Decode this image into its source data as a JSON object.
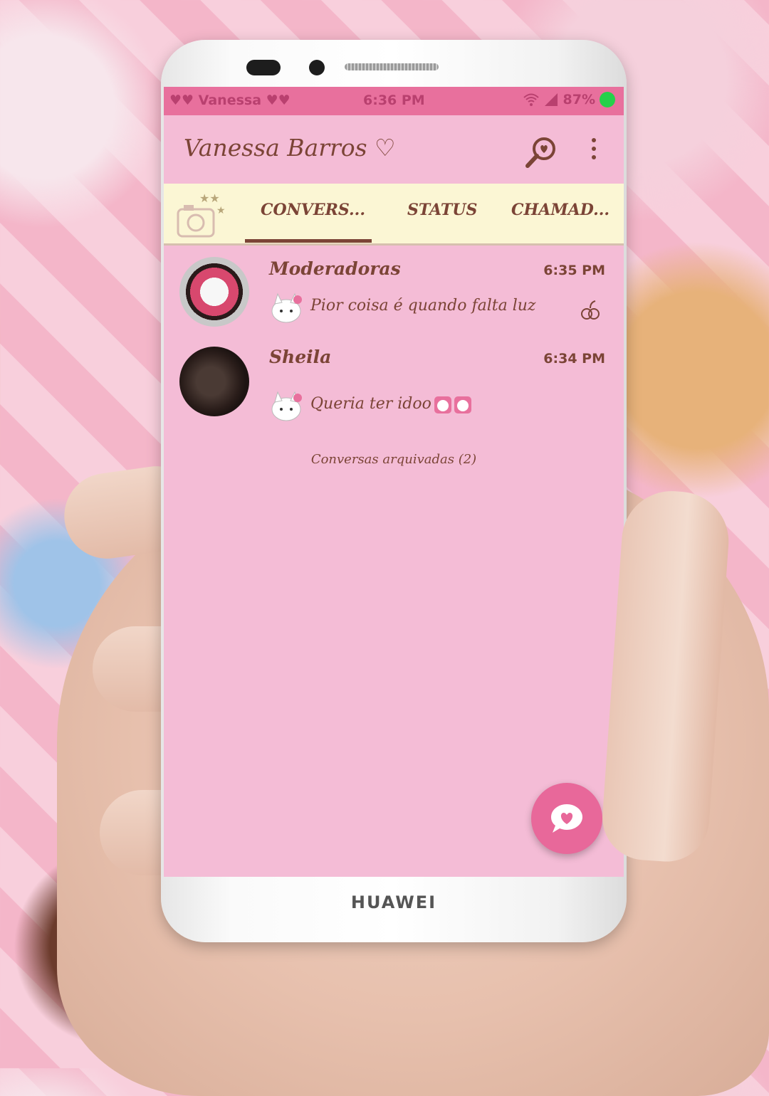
{
  "device": {
    "brand": "HUAWEI"
  },
  "status_bar": {
    "carrier": "♥♥ Vanessa ♥♥",
    "time": "6:36 PM",
    "battery": "87%"
  },
  "app_bar": {
    "title": "Vanessa Barros ♡",
    "search_icon": "search-icon",
    "menu_icon": "more-vert-icon"
  },
  "tabs": [
    {
      "label": "CONVERS...",
      "selected": true
    },
    {
      "label": "STATUS",
      "selected": false
    },
    {
      "label": "CHAMAD...",
      "selected": false
    }
  ],
  "chats": [
    {
      "name": "Moderadoras",
      "time": "6:35 PM",
      "message": "Pior coisa é quando falta luz",
      "muted": true
    },
    {
      "name": "Sheila",
      "time": "6:34 PM",
      "message": "Queria ter idoo",
      "muted": false
    }
  ],
  "archived_label": "Conversas arquivadas (2)",
  "colors": {
    "status_bar": "#e8709d",
    "background": "#f4bcd6",
    "tabs_bg": "#fbf6d4",
    "text": "#7b4436",
    "fab": "#e8689a"
  }
}
